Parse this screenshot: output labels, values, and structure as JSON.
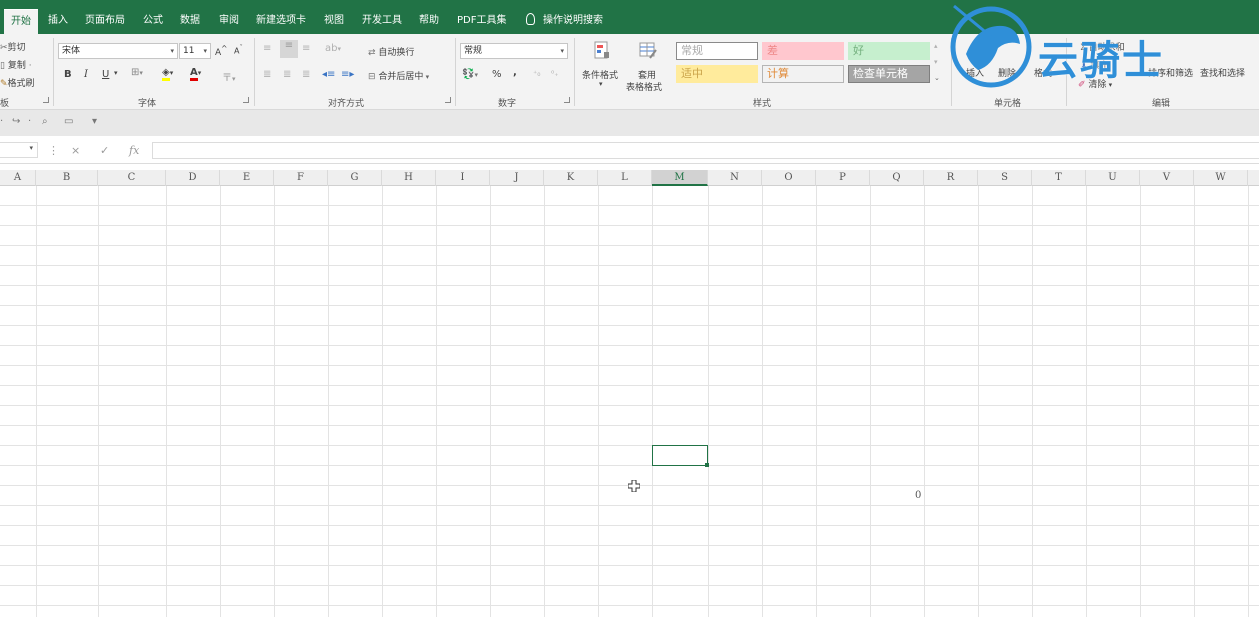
{
  "tabs": [
    {
      "label": "开始",
      "active": true
    },
    {
      "label": "插入"
    },
    {
      "label": "页面布局"
    },
    {
      "label": "公式"
    },
    {
      "label": "数据"
    },
    {
      "label": "审阅"
    },
    {
      "label": "新建选项卡"
    },
    {
      "label": "视图"
    },
    {
      "label": "开发工具"
    },
    {
      "label": "帮助"
    },
    {
      "label": "PDF工具集"
    },
    {
      "label": "操作说明搜索"
    }
  ],
  "clipboard": {
    "cut": "剪切",
    "copy": "复制",
    "format_painter": "格式刷",
    "group_label": "板"
  },
  "font": {
    "name": "宋体",
    "size": "11",
    "bold": "B",
    "italic": "I",
    "underline": "U",
    "grow": "A",
    "shrink": "A",
    "font_color": "A",
    "group_label": "字体"
  },
  "alignment": {
    "wrap_text": "自动换行",
    "merge_center": "合并后居中",
    "group_label": "对齐方式"
  },
  "number": {
    "format": "常规",
    "percent": "%",
    "comma": ",",
    "group_label": "数字"
  },
  "styles": {
    "conditional_format": "条件格式",
    "table_format_1": "套用",
    "table_format_2": "表格格式",
    "cells": [
      {
        "label": "常规",
        "bg": "#ffffff",
        "fg": "#aaaaaa",
        "border": "#8a8a8a"
      },
      {
        "label": "差",
        "bg": "#ffc7ce",
        "fg": "#ee8888",
        "border": "#ffc7ce"
      },
      {
        "label": "好",
        "bg": "#c6efce",
        "fg": "#74b07e",
        "border": "#c6efce"
      },
      {
        "label": "适中",
        "bg": "#ffeb9c",
        "fg": "#caa34a",
        "border": "#ffeb9c"
      },
      {
        "label": "计算",
        "bg": "#f2f2f2",
        "fg": "#e08b3a",
        "border": "#b5b5b5"
      },
      {
        "label": "检查单元格",
        "bg": "#a5a5a5",
        "fg": "#ffffff",
        "border": "#7f7f7f"
      }
    ],
    "group_label": "样式"
  },
  "cells_group": {
    "insert": "插入",
    "delete": "删除",
    "format": "格式",
    "group_label": "单元格"
  },
  "editing": {
    "autosum": "自动求和",
    "fill": "填充",
    "clear": "清除",
    "sort_filter": "排序和筛选",
    "find_select": "查找和选择",
    "group_label": "编辑"
  },
  "formula_bar": {
    "cancel": "×",
    "enter": "✓",
    "fx": "fx"
  },
  "columns": [
    "A",
    "B",
    "C",
    "D",
    "E",
    "F",
    "G",
    "H",
    "I",
    "J",
    "K",
    "L",
    "M",
    "N",
    "O",
    "P",
    "Q",
    "R",
    "S",
    "T",
    "U",
    "V",
    "W"
  ],
  "selected_column": "M",
  "cell_values": [
    {
      "cell": "Q-r16",
      "value": "0"
    }
  ],
  "watermark": {
    "text": "云骑士",
    "color": "#2f8fd8"
  },
  "colors": {
    "accent": "#217346"
  }
}
